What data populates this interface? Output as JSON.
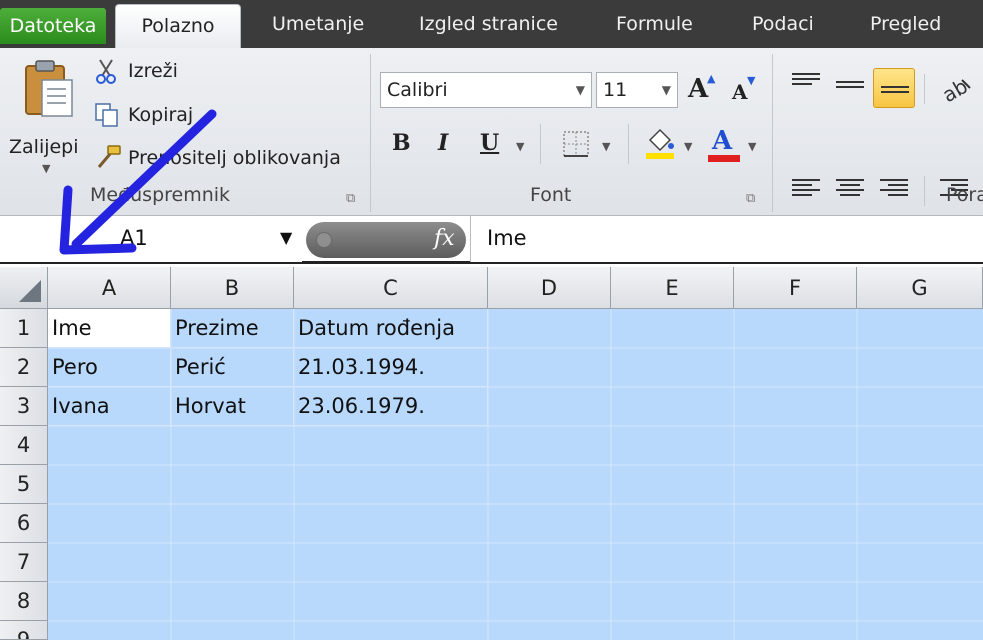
{
  "tabs": {
    "file": "Datoteka",
    "home": "Polazno",
    "insert": "Umetanje",
    "page_layout": "Izgled stranice",
    "formulas": "Formule",
    "data": "Podaci",
    "review": "Pregled"
  },
  "clipboard": {
    "paste": "Zalijepi",
    "cut": "Izreži",
    "copy": "Kopiraj",
    "format_painter": "Prenositelj oblikovanja",
    "group": "Međuspremnik"
  },
  "font": {
    "name": "Calibri",
    "size": "11",
    "bold": "B",
    "italic": "I",
    "underline": "U",
    "grow": "A",
    "shrink": "A",
    "color_letter": "A",
    "group": "Font"
  },
  "alignment": {
    "group_partial": "Pora"
  },
  "formula_bar": {
    "name_box": "A1",
    "fx": "fx",
    "value": "Ime"
  },
  "sheet": {
    "columns": [
      "A",
      "B",
      "C",
      "D",
      "E",
      "F",
      "G"
    ],
    "rows": [
      "1",
      "2",
      "3",
      "4",
      "5",
      "6",
      "7",
      "8",
      "9"
    ],
    "cells": [
      [
        "Ime",
        "Prezime",
        "Datum rođenja"
      ],
      [
        "Pero",
        "Perić",
        "21.03.1994."
      ],
      [
        "Ivana",
        "Horvat",
        "23.06.1979."
      ]
    ]
  },
  "colors": {
    "selection": "#b8d8fc",
    "annotation_arrow": "#2424e0",
    "file_tab": "#3a9e2a",
    "font_color_bar": "#e02020",
    "fill_color_bar": "#ffe000"
  }
}
